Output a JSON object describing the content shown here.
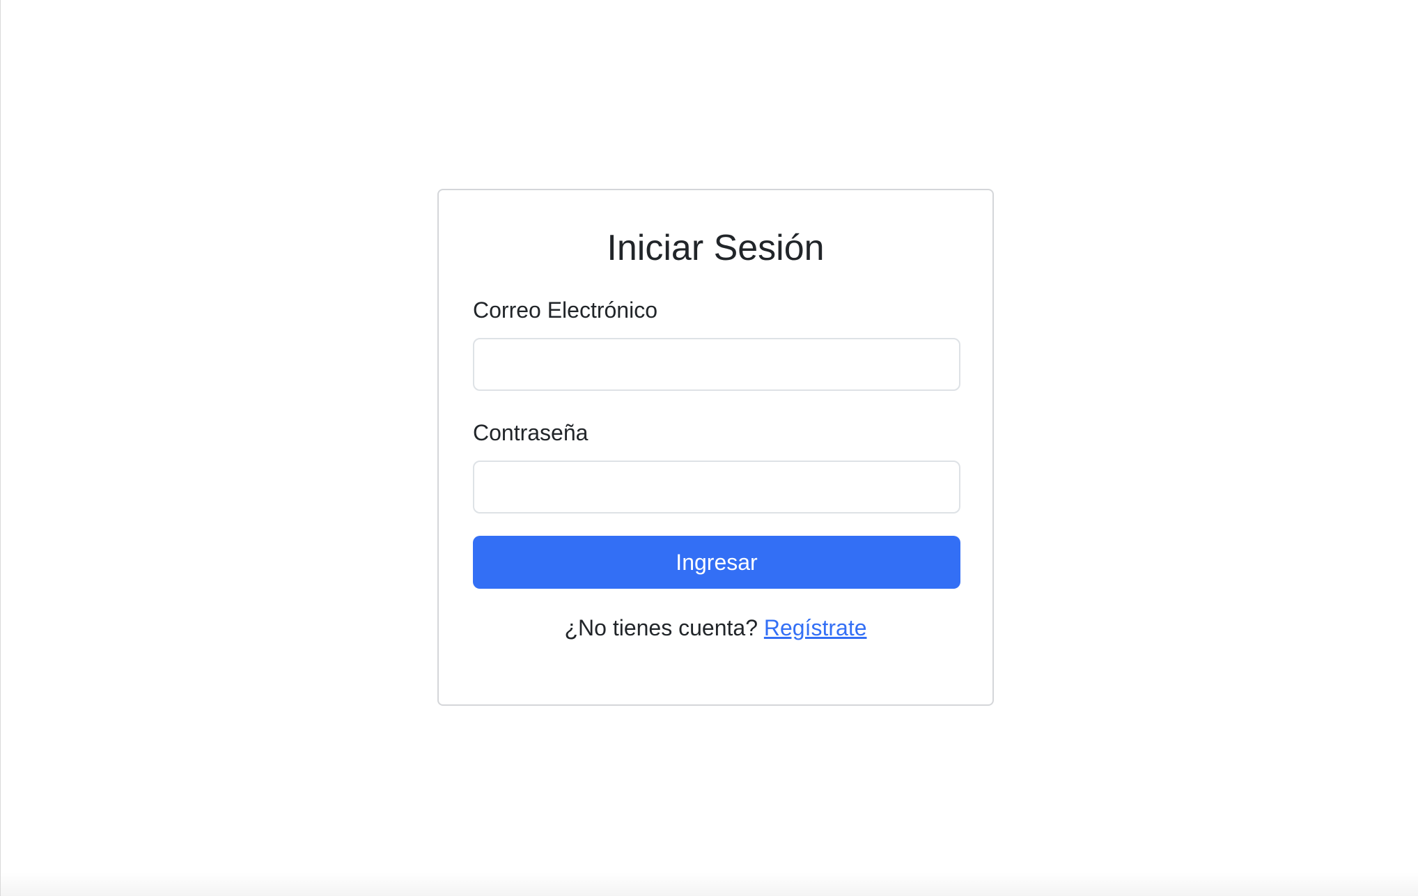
{
  "login": {
    "title": "Iniciar Sesión",
    "email_label": "Correo Electrónico",
    "email_value": "",
    "password_label": "Contraseña",
    "password_value": "",
    "submit_label": "Ingresar",
    "footer_text": "¿No tienes cuenta?",
    "register_link": "Regístrate"
  },
  "colors": {
    "accent": "#336ff5",
    "text": "#212529",
    "border": "#d4d6d9"
  }
}
